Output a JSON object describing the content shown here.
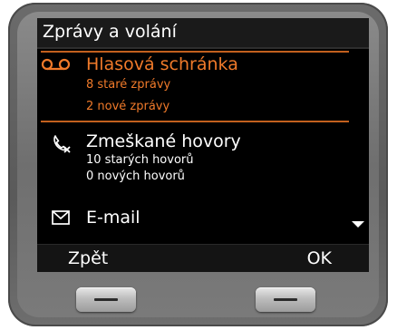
{
  "screen": {
    "title": "Zprávy a volání",
    "items": [
      {
        "icon": "voicemail-icon",
        "title": "Hlasová schránka",
        "lines": [
          "8 staré zprávy",
          "2 nové zprávy"
        ],
        "selected": true
      },
      {
        "icon": "missed-call-icon",
        "title": "Zmeškané hovory",
        "lines": [
          "10 starých hovorů",
          "0 nových hovorů"
        ],
        "selected": false
      },
      {
        "icon": "envelope-icon",
        "title": "E-mail",
        "lines": [],
        "selected": false
      }
    ]
  },
  "softkeys": {
    "left": "Zpět",
    "right": "OK"
  },
  "colors": {
    "highlight": "#f07a2a",
    "text": "#ffffff",
    "screen_bg": "#000000",
    "device_body": "#6b6b6b"
  }
}
